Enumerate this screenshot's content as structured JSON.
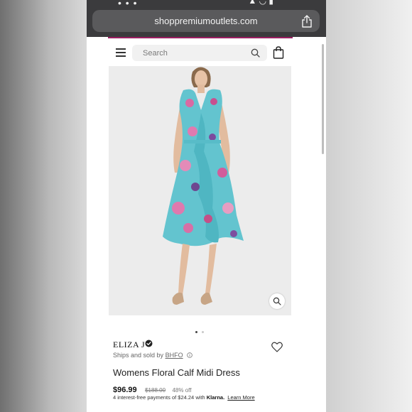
{
  "browser": {
    "status_left": "• • •",
    "status_right": "▲ ◡ ▮",
    "url": "shoppremiumoutlets.com"
  },
  "header": {
    "search_placeholder": "Search"
  },
  "product": {
    "brand": "ELIZA J",
    "ships_prefix": "Ships and sold by",
    "seller": "BHFO",
    "title": "Womens Floral Calf Midi Dress",
    "price": "$96.99",
    "original_price": "$188.00",
    "discount": "48% off",
    "installments_text": "4 interest-free payments of $24.24 with",
    "installments_provider": "Klarna.",
    "learn_more": "Learn More"
  },
  "gallery": {
    "current_index": 1,
    "total": 2
  },
  "colors": {
    "topbar": "#3b3b3d",
    "accent": "#9b1e62",
    "dress": "#63c4cf"
  },
  "icons": [
    "menu-icon",
    "search-icon",
    "shopping-bag-icon",
    "share-icon",
    "zoom-icon",
    "verified-icon",
    "info-icon",
    "heart-icon"
  ]
}
